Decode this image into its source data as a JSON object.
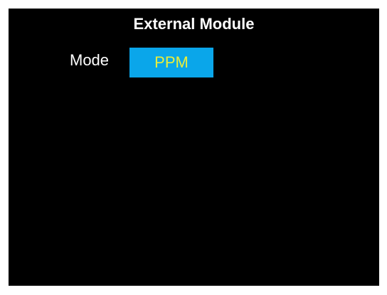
{
  "screen": {
    "title": "External Module",
    "mode": {
      "label": "Mode",
      "value": "PPM"
    }
  },
  "colors": {
    "background": "#000000",
    "text": "#ffffff",
    "selection_background": "#0aa6ea",
    "selection_text": "#e9ee3c"
  }
}
